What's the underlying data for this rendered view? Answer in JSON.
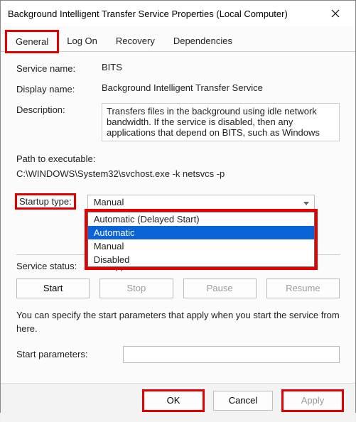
{
  "window": {
    "title": "Background Intelligent Transfer Service Properties (Local Computer)"
  },
  "tabs": {
    "items": [
      {
        "label": "General",
        "active": true
      },
      {
        "label": "Log On",
        "active": false
      },
      {
        "label": "Recovery",
        "active": false
      },
      {
        "label": "Dependencies",
        "active": false
      }
    ]
  },
  "fields": {
    "service_name_label": "Service name:",
    "service_name_value": "BITS",
    "display_name_label": "Display name:",
    "display_name_value": "Background Intelligent Transfer Service",
    "description_label": "Description:",
    "description_value": "Transfers files in the background using idle network bandwidth. If the service is disabled, then any applications that depend on BITS, such as Windows",
    "path_label": "Path to executable:",
    "path_value": "C:\\WINDOWS\\System32\\svchost.exe -k netsvcs -p",
    "startup_type_label": "Startup type:",
    "startup_type_value": "Manual",
    "startup_type_options": [
      {
        "label": "Automatic (Delayed Start)",
        "hl": false
      },
      {
        "label": "Automatic",
        "hl": true
      },
      {
        "label": "Manual",
        "hl": false
      },
      {
        "label": "Disabled",
        "hl": false
      }
    ],
    "service_status_label": "Service status:",
    "service_status_value": "Stopped",
    "hint": "You can specify the start parameters that apply when you start the service from here.",
    "start_params_label": "Start parameters:",
    "start_params_value": ""
  },
  "buttons": {
    "start": "Start",
    "stop": "Stop",
    "pause": "Pause",
    "resume": "Resume",
    "ok": "OK",
    "cancel": "Cancel",
    "apply": "Apply"
  }
}
